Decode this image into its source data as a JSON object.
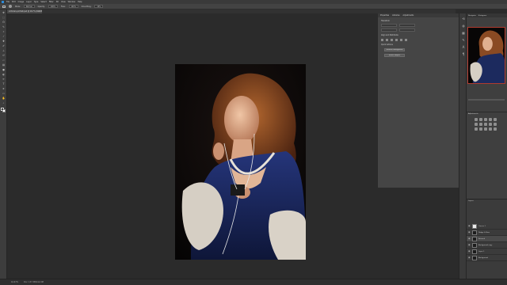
{
  "menubar": {
    "items": [
      "File",
      "Edit",
      "Image",
      "Layer",
      "Type",
      "Select",
      "Filter",
      "3D",
      "View",
      "Window",
      "Help"
    ]
  },
  "options_bar": {
    "items": [
      "Mode:",
      "Normal",
      "Opacity:",
      "100%",
      "Flow:",
      "100%",
      "Smoothing:",
      "10%"
    ]
  },
  "document_tab": {
    "title": "victorian-portrait.psd @ 16.7% (RGB/8)"
  },
  "toolbar": {
    "tools": [
      "move-icon",
      "marquee-icon",
      "lasso-icon",
      "quick-select-icon",
      "crop-icon",
      "eyedropper-icon",
      "healing-icon",
      "brush-icon",
      "clone-stamp-icon",
      "history-brush-icon",
      "eraser-icon",
      "gradient-icon",
      "blur-icon",
      "dodge-icon",
      "pen-icon",
      "type-icon",
      "path-select-icon",
      "rectangle-icon",
      "hand-icon",
      "zoom-icon"
    ],
    "foreground_color": "#111111",
    "background_color": "#ffffff"
  },
  "properties_panel": {
    "tabs": [
      "Properties",
      "Libraries",
      "Adjustments"
    ],
    "sections": [
      "Transform",
      "Align and Distribute",
      "Quick Actions"
    ],
    "buttons": [
      "Remove Background",
      "Select Subject"
    ]
  },
  "right_panel": {
    "navigator_tabs": [
      "Navigator",
      "Histogram"
    ],
    "adjustments_title": "Adjustments",
    "layers_title": "Layers",
    "layers": [
      {
        "name": "Curves 1",
        "thumb": "white",
        "selected": false
      },
      {
        "name": "Dodge & Burn",
        "thumb": "dark",
        "selected": false
      },
      {
        "name": "Retouch",
        "thumb": "dark",
        "selected": true
      },
      {
        "name": "Background copy",
        "thumb": "dark",
        "selected": false
      },
      {
        "name": "Layer 1",
        "thumb": "dark",
        "selected": false
      },
      {
        "name": "Background",
        "thumb": "dark",
        "selected": false
      }
    ]
  },
  "status_bar": {
    "zoom": "16.67%",
    "doc_info": "Doc: 137.3M/412.0M"
  },
  "colors": {
    "workspace": "#2b2b2b",
    "panel": "#454545",
    "dress": "#1c2a5e",
    "hair": "#8a4a23",
    "accent_selection": "#b03a2e"
  }
}
